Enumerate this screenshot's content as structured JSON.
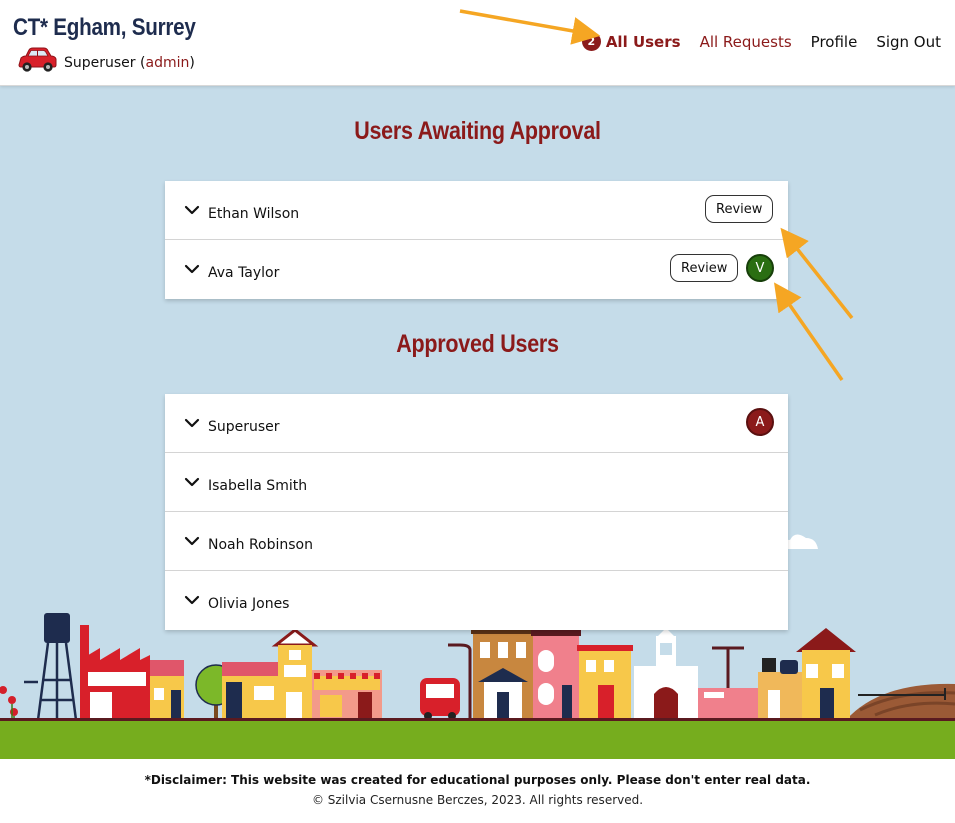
{
  "header": {
    "brand": "CT* Egham, Surrey",
    "user_name": "Superuser",
    "user_role": "admin",
    "car_icon": "car-icon"
  },
  "nav": {
    "all_users": {
      "label": "All Users",
      "badge": "2"
    },
    "all_requests": "All Requests",
    "profile": "Profile",
    "sign_out": "Sign Out"
  },
  "awaiting": {
    "title": "Users Awaiting Approval",
    "users": [
      {
        "name": "Ethan Wilson",
        "review_label": "Review"
      },
      {
        "name": "Ava Taylor",
        "review_label": "Review",
        "status": "V"
      }
    ]
  },
  "approved": {
    "title": "Approved Users",
    "users": [
      {
        "name": "Superuser",
        "status": "A"
      },
      {
        "name": "Isabella Smith"
      },
      {
        "name": "Noah Robinson"
      },
      {
        "name": "Olivia Jones"
      }
    ]
  },
  "footer": {
    "disclaimer": "*Disclaimer: This website was created for educational purposes only. Please don't enter real data.",
    "copyright": "© Szilvia Csernusne Berczes, 2023. All rights reserved."
  },
  "colors": {
    "accent": "#8b1a1a",
    "brand_navy": "#1e2c4e",
    "sky": "#c5dce9",
    "grass": "#76ad1e",
    "arrow": "#f5a623",
    "status_green": "#2a6e12"
  }
}
